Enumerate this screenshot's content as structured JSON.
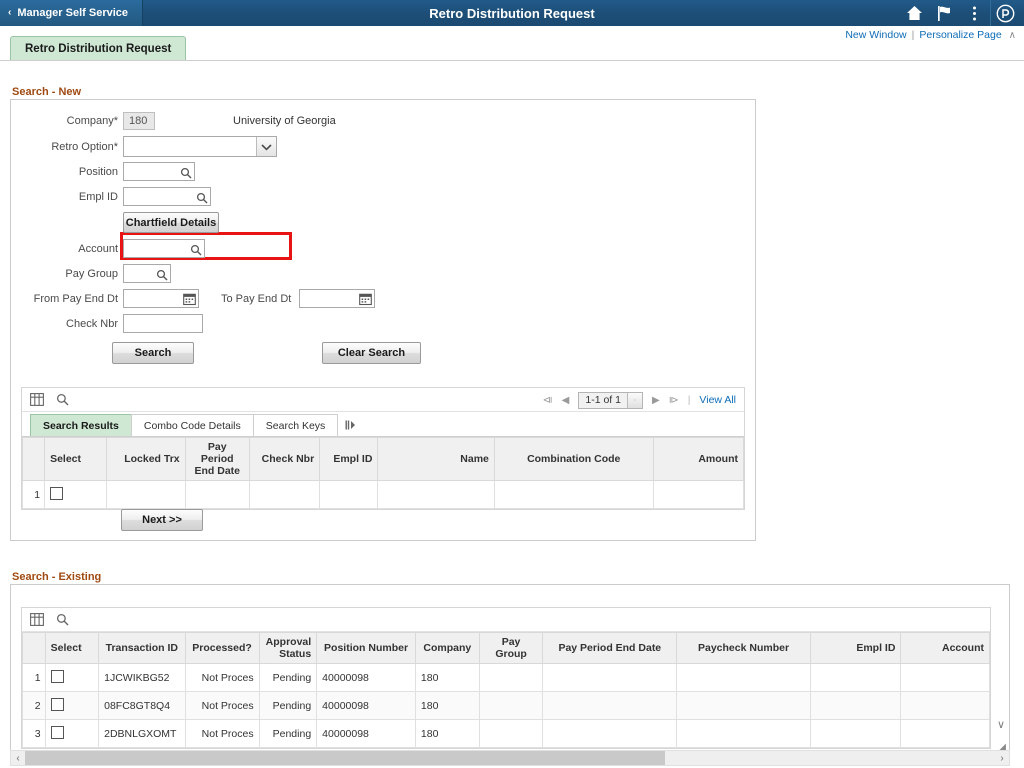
{
  "header": {
    "breadcrumb_label": "Manager Self Service",
    "back_chevron": "‹",
    "title": "Retro Distribution Request",
    "icons": [
      "home-icon",
      "flag-icon",
      "actions-menu-icon",
      "app-logo-icon"
    ]
  },
  "links": {
    "new_window": "New Window",
    "separator": "|",
    "personalize_page": "Personalize Page",
    "collapse_caret": "∧"
  },
  "page_tab": {
    "label": "Retro Distribution Request"
  },
  "search_new": {
    "section_title": "Search - New",
    "fields": {
      "company_label": "Company*",
      "company_value": "180",
      "company_description": "University of Georgia",
      "retro_option_label": "Retro Option*",
      "retro_option_value": "",
      "position_label": "Position",
      "position_value": "",
      "empl_id_label": "Empl ID",
      "empl_id_value": "",
      "chartfield_button": "Chartfield Details",
      "account_label": "Account",
      "account_value": "",
      "pay_group_label": "Pay Group",
      "pay_group_value": "",
      "from_pay_end_dt_label": "From Pay End Dt",
      "from_pay_end_dt_value": "",
      "to_pay_end_dt_label": "To Pay End Dt",
      "to_pay_end_dt_value": "",
      "check_nbr_label": "Check Nbr",
      "check_nbr_value": ""
    },
    "buttons": {
      "search": "Search",
      "clear_search": "Clear Search",
      "next": "Next >>"
    }
  },
  "results_grid": {
    "toolbar": {
      "personalize_icon": "grid-personalize-icon",
      "find_icon": "search-icon"
    },
    "pager": {
      "first": "⧏",
      "prev": "◀",
      "range": "1-1 of 1",
      "next": "▶",
      "last": "⧐",
      "separator": "|",
      "view_all": "View All"
    },
    "tabs": [
      {
        "label": "Search Results",
        "active": true
      },
      {
        "label": "Combo Code Details",
        "active": false
      },
      {
        "label": "Search Keys",
        "active": false
      }
    ],
    "tab_more_icon": "tabs-overflow-icon",
    "columns": [
      "Select",
      "Locked Trx",
      "Pay Period End Date",
      "Check Nbr",
      "Empl ID",
      "Name",
      "Combination Code",
      "Amount"
    ],
    "rows": [
      {
        "num": "1",
        "select": false,
        "locked_trx": "",
        "pay_period_end_date": "",
        "check_nbr": "",
        "empl_id": "",
        "name": "",
        "combination_code": "",
        "amount": ""
      }
    ]
  },
  "search_existing": {
    "section_title": "Search - Existing",
    "toolbar": {
      "personalize_icon": "grid-personalize-icon",
      "find_icon": "search-icon"
    },
    "columns": [
      "Select",
      "Transaction ID",
      "Processed?",
      "Approval Status",
      "Position Number",
      "Company",
      "Pay Group",
      "Pay Period End Date",
      "Paycheck Number",
      "Empl ID",
      "Account"
    ],
    "rows": [
      {
        "num": "1",
        "select": false,
        "transaction_id": "1JCWIKBG52",
        "processed": "Not Proces",
        "approval_status": "Pending",
        "position_number": "40000098",
        "company": "180",
        "pay_group": "",
        "pay_period_end_date": "",
        "paycheck_number": "",
        "empl_id": "",
        "account": ""
      },
      {
        "num": "2",
        "select": false,
        "transaction_id": "08FC8GT8Q4",
        "processed": "Not Proces",
        "approval_status": "Pending",
        "position_number": "40000098",
        "company": "180",
        "pay_group": "",
        "pay_period_end_date": "",
        "paycheck_number": "",
        "empl_id": "",
        "account": ""
      },
      {
        "num": "3",
        "select": false,
        "transaction_id": "2DBNLGXOMT",
        "processed": "Not Proces",
        "approval_status": "Pending",
        "position_number": "40000098",
        "company": "180",
        "pay_group": "",
        "pay_period_end_date": "",
        "paycheck_number": "",
        "empl_id": "",
        "account": ""
      }
    ],
    "scroll": {
      "left_arrow": "‹",
      "right_arrow": "›",
      "down_caret": "∨"
    }
  },
  "colors": {
    "header_blue": "#1d4f78",
    "tab_green": "#cfe8d4",
    "section_orange": "#a04a12",
    "link_blue": "#0e6cb5",
    "highlight_red": "#e81313"
  }
}
